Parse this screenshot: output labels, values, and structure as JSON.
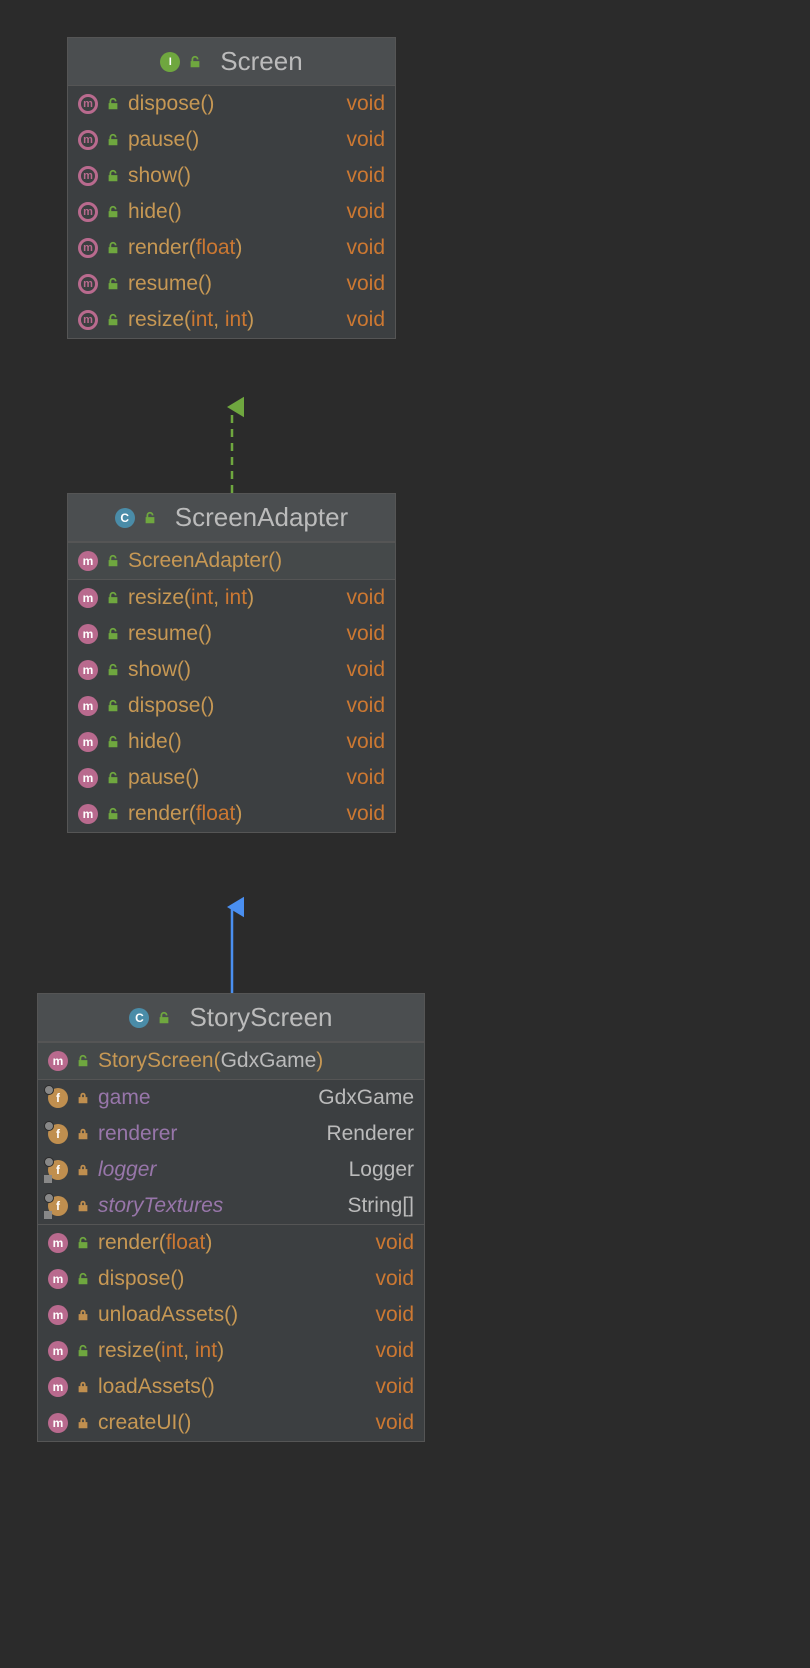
{
  "colors": {
    "keyword": "#cc7832",
    "member": "#c79854",
    "field": "#9876aa",
    "text": "#bbbbbb"
  },
  "classes": {
    "screen": {
      "kind": "interface",
      "name": "Screen",
      "members": [
        {
          "icon": "method-abstract",
          "vis": "public",
          "name": "dispose",
          "params": [],
          "ret": "void",
          "retK": true
        },
        {
          "icon": "method-abstract",
          "vis": "public",
          "name": "pause",
          "params": [],
          "ret": "void",
          "retK": true
        },
        {
          "icon": "method-abstract",
          "vis": "public",
          "name": "show",
          "params": [],
          "ret": "void",
          "retK": true
        },
        {
          "icon": "method-abstract",
          "vis": "public",
          "name": "hide",
          "params": [],
          "ret": "void",
          "retK": true
        },
        {
          "icon": "method-abstract",
          "vis": "public",
          "name": "render",
          "params": [
            "float"
          ],
          "ret": "void",
          "retK": true
        },
        {
          "icon": "method-abstract",
          "vis": "public",
          "name": "resume",
          "params": [],
          "ret": "void",
          "retK": true
        },
        {
          "icon": "method-abstract",
          "vis": "public",
          "name": "resize",
          "params": [
            "int",
            "int"
          ],
          "ret": "void",
          "retK": true
        }
      ]
    },
    "adapter": {
      "kind": "class",
      "name": "ScreenAdapter",
      "constructors": [
        {
          "icon": "method",
          "vis": "public",
          "name": "ScreenAdapter",
          "params": []
        }
      ],
      "members": [
        {
          "icon": "method",
          "vis": "public",
          "name": "resize",
          "params": [
            "int",
            "int"
          ],
          "ret": "void",
          "retK": true
        },
        {
          "icon": "method",
          "vis": "public",
          "name": "resume",
          "params": [],
          "ret": "void",
          "retK": true
        },
        {
          "icon": "method",
          "vis": "public",
          "name": "show",
          "params": [],
          "ret": "void",
          "retK": true
        },
        {
          "icon": "method",
          "vis": "public",
          "name": "dispose",
          "params": [],
          "ret": "void",
          "retK": true
        },
        {
          "icon": "method",
          "vis": "public",
          "name": "hide",
          "params": [],
          "ret": "void",
          "retK": true
        },
        {
          "icon": "method",
          "vis": "public",
          "name": "pause",
          "params": [],
          "ret": "void",
          "retK": true
        },
        {
          "icon": "method",
          "vis": "public",
          "name": "render",
          "params": [
            "float"
          ],
          "ret": "void",
          "retK": true
        }
      ]
    },
    "story": {
      "kind": "class",
      "name": "StoryScreen",
      "constructors": [
        {
          "icon": "method",
          "vis": "public",
          "name": "StoryScreen",
          "params": [
            "GdxGame"
          ],
          "paramPlain": true
        }
      ],
      "fields": [
        {
          "icon": "field",
          "vis": "private",
          "name": "game",
          "italic": false,
          "overlay": true,
          "ret": "GdxGame"
        },
        {
          "icon": "field",
          "vis": "private",
          "name": "renderer",
          "italic": false,
          "overlay": true,
          "ret": "Renderer"
        },
        {
          "icon": "field",
          "vis": "private",
          "name": "logger",
          "italic": true,
          "overlay": true,
          "static": true,
          "ret": "Logger"
        },
        {
          "icon": "field",
          "vis": "private",
          "name": "storyTextures",
          "italic": true,
          "overlay": true,
          "static": true,
          "ret": "String[]"
        }
      ],
      "members": [
        {
          "icon": "method",
          "vis": "public",
          "name": "render",
          "params": [
            "float"
          ],
          "ret": "void",
          "retK": true
        },
        {
          "icon": "method",
          "vis": "public",
          "name": "dispose",
          "params": [],
          "ret": "void",
          "retK": true
        },
        {
          "icon": "method",
          "vis": "private",
          "name": "unloadAssets",
          "params": [],
          "ret": "void",
          "retK": true
        },
        {
          "icon": "method",
          "vis": "public",
          "name": "resize",
          "params": [
            "int",
            "int"
          ],
          "ret": "void",
          "retK": true
        },
        {
          "icon": "method",
          "vis": "private",
          "name": "loadAssets",
          "params": [],
          "ret": "void",
          "retK": true
        },
        {
          "icon": "method",
          "vis": "private",
          "name": "createUI",
          "params": [],
          "ret": "void",
          "retK": true
        }
      ]
    }
  }
}
